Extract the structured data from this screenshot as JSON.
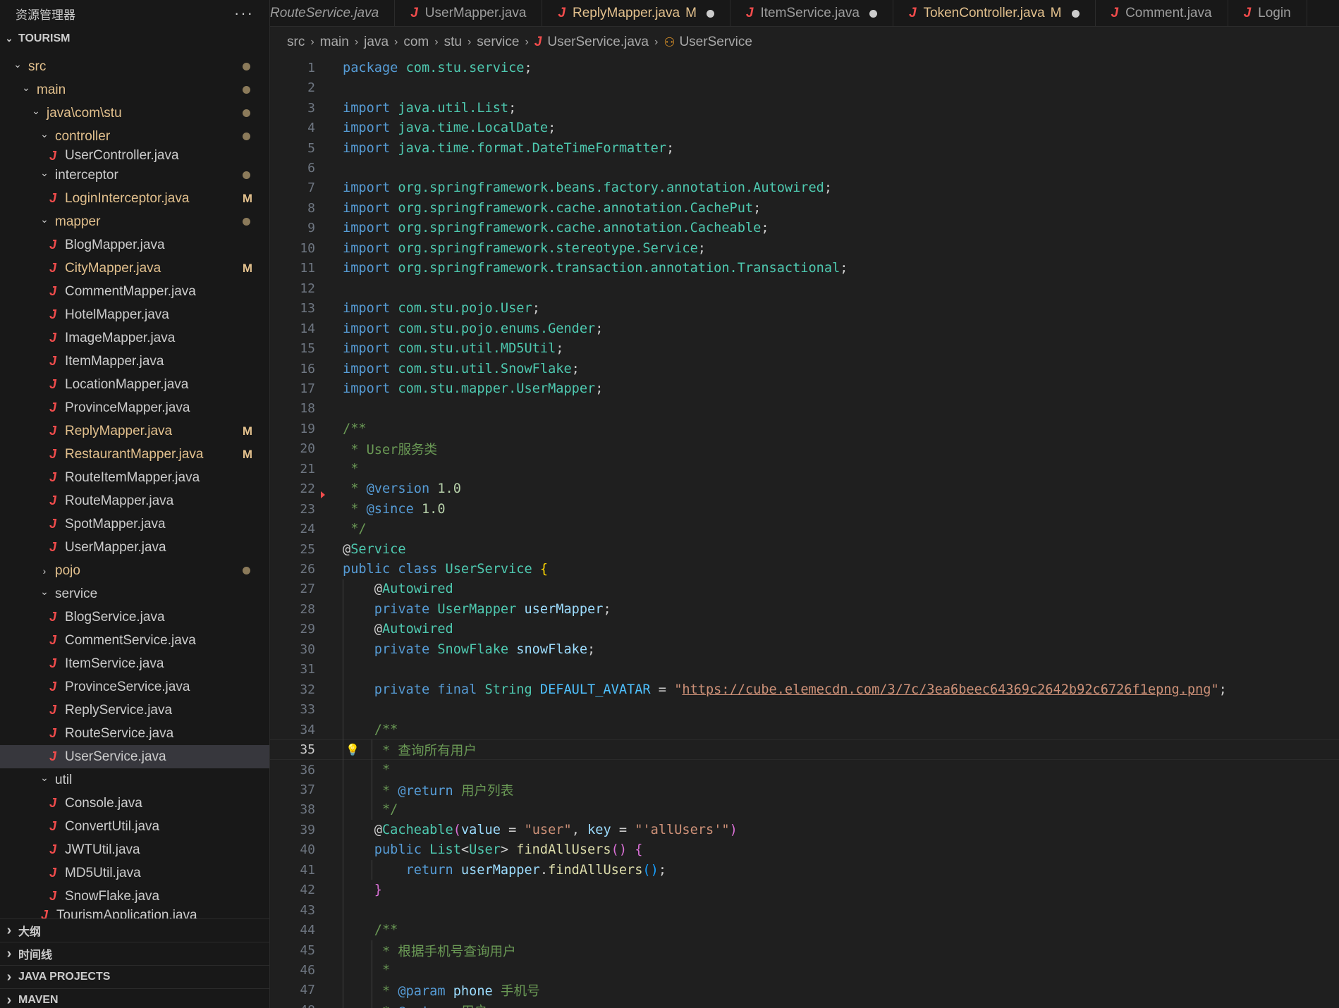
{
  "sidebar": {
    "title": "资源管理器",
    "more_icon": "ellipsis-icon",
    "root": "TOURISM",
    "tree": [
      {
        "label": "src",
        "depth": 1,
        "kind": "dir",
        "open": true,
        "dot": true
      },
      {
        "label": "main",
        "depth": 2,
        "kind": "dir",
        "open": true,
        "dot": true
      },
      {
        "label": "java\\com\\stu",
        "depth": 3,
        "kind": "dir",
        "open": true,
        "dot": true
      },
      {
        "label": "controller",
        "depth": 4,
        "kind": "dir",
        "open": true,
        "dot": true
      },
      {
        "label": "UserController.java",
        "depth": 5,
        "kind": "file",
        "partial": true
      },
      {
        "label": "interceptor",
        "depth": 4,
        "kind": "folder",
        "open": true,
        "dot": true
      },
      {
        "label": "LoginInterceptor.java",
        "depth": 5,
        "kind": "file",
        "modified": true,
        "badge": "M"
      },
      {
        "label": "mapper",
        "depth": 4,
        "kind": "dir",
        "open": true,
        "dot": true
      },
      {
        "label": "BlogMapper.java",
        "depth": 5,
        "kind": "file"
      },
      {
        "label": "CityMapper.java",
        "depth": 5,
        "kind": "file",
        "modified": true,
        "badge": "M"
      },
      {
        "label": "CommentMapper.java",
        "depth": 5,
        "kind": "file"
      },
      {
        "label": "HotelMapper.java",
        "depth": 5,
        "kind": "file"
      },
      {
        "label": "ImageMapper.java",
        "depth": 5,
        "kind": "file"
      },
      {
        "label": "ItemMapper.java",
        "depth": 5,
        "kind": "file"
      },
      {
        "label": "LocationMapper.java",
        "depth": 5,
        "kind": "file"
      },
      {
        "label": "ProvinceMapper.java",
        "depth": 5,
        "kind": "file"
      },
      {
        "label": "ReplyMapper.java",
        "depth": 5,
        "kind": "file",
        "modified": true,
        "badge": "M"
      },
      {
        "label": "RestaurantMapper.java",
        "depth": 5,
        "kind": "file",
        "modified": true,
        "badge": "M"
      },
      {
        "label": "RouteItemMapper.java",
        "depth": 5,
        "kind": "file"
      },
      {
        "label": "RouteMapper.java",
        "depth": 5,
        "kind": "file"
      },
      {
        "label": "SpotMapper.java",
        "depth": 5,
        "kind": "file"
      },
      {
        "label": "UserMapper.java",
        "depth": 5,
        "kind": "file"
      },
      {
        "label": "pojo",
        "depth": 4,
        "kind": "dir",
        "open": false,
        "dot": true
      },
      {
        "label": "service",
        "depth": 4,
        "kind": "folder",
        "open": true
      },
      {
        "label": "BlogService.java",
        "depth": 5,
        "kind": "file"
      },
      {
        "label": "CommentService.java",
        "depth": 5,
        "kind": "file"
      },
      {
        "label": "ItemService.java",
        "depth": 5,
        "kind": "file"
      },
      {
        "label": "ProvinceService.java",
        "depth": 5,
        "kind": "file"
      },
      {
        "label": "ReplyService.java",
        "depth": 5,
        "kind": "file"
      },
      {
        "label": "RouteService.java",
        "depth": 5,
        "kind": "file"
      },
      {
        "label": "UserService.java",
        "depth": 5,
        "kind": "file",
        "selected": true
      },
      {
        "label": "util",
        "depth": 4,
        "kind": "folder",
        "open": true
      },
      {
        "label": "Console.java",
        "depth": 5,
        "kind": "file"
      },
      {
        "label": "ConvertUtil.java",
        "depth": 5,
        "kind": "file"
      },
      {
        "label": "JWTUtil.java",
        "depth": 5,
        "kind": "file"
      },
      {
        "label": "MD5Util.java",
        "depth": 5,
        "kind": "file"
      },
      {
        "label": "SnowFlake.java",
        "depth": 5,
        "kind": "file"
      },
      {
        "label": "TourismApplication.java",
        "depth": 4,
        "kind": "file",
        "partial": true
      }
    ],
    "sections": [
      "大纲",
      "时间线",
      "JAVA PROJECTS",
      "MAVEN"
    ]
  },
  "tabs": [
    {
      "label": "RouteService.java",
      "icon": false,
      "italic": true
    },
    {
      "label": "UserMapper.java",
      "icon": true
    },
    {
      "label": "ReplyMapper.java",
      "icon": true,
      "modified": true,
      "mark": "M",
      "dot": true
    },
    {
      "label": "ItemService.java",
      "icon": true,
      "dot": true
    },
    {
      "label": "TokenController.java",
      "icon": true,
      "modified": true,
      "mark": "M",
      "dot": true
    },
    {
      "label": "Comment.java",
      "icon": true
    },
    {
      "label": "Login",
      "icon": true
    }
  ],
  "breadcrumb": [
    "src",
    "main",
    "java",
    "com",
    "stu",
    "service",
    "UserService.java",
    "UserService"
  ],
  "editor": {
    "current_line": 35,
    "lines": [
      {
        "n": 1,
        "t": [
          [
            "kw",
            "package "
          ],
          [
            "pkg",
            "com.stu.service"
          ],
          [
            "",
            "; "
          ]
        ]
      },
      {
        "n": 2,
        "t": []
      },
      {
        "n": 3,
        "t": [
          [
            "kw",
            "import "
          ],
          [
            "pkg",
            "java.util.List"
          ],
          [
            "",
            ";"
          ]
        ]
      },
      {
        "n": 4,
        "t": [
          [
            "kw",
            "import "
          ],
          [
            "pkg",
            "java.time.LocalDate"
          ],
          [
            "",
            ";"
          ]
        ]
      },
      {
        "n": 5,
        "t": [
          [
            "kw",
            "import "
          ],
          [
            "pkg",
            "java.time.format.DateTimeFormatter"
          ],
          [
            "",
            ";"
          ]
        ]
      },
      {
        "n": 6,
        "t": []
      },
      {
        "n": 7,
        "t": [
          [
            "kw",
            "import "
          ],
          [
            "pkg",
            "org.springframework.beans.factory.annotation.Autowired"
          ],
          [
            "",
            ";"
          ]
        ]
      },
      {
        "n": 8,
        "t": [
          [
            "kw",
            "import "
          ],
          [
            "pkg",
            "org.springframework.cache.annotation.CachePut"
          ],
          [
            "",
            ";"
          ]
        ]
      },
      {
        "n": 9,
        "t": [
          [
            "kw",
            "import "
          ],
          [
            "pkg",
            "org.springframework.cache.annotation.Cacheable"
          ],
          [
            "",
            ";"
          ]
        ]
      },
      {
        "n": 10,
        "t": [
          [
            "kw",
            "import "
          ],
          [
            "pkg",
            "org.springframework.stereotype.Service"
          ],
          [
            "",
            ";"
          ]
        ]
      },
      {
        "n": 11,
        "t": [
          [
            "kw",
            "import "
          ],
          [
            "pkg",
            "org.springframework.transaction.annotation.Transactional"
          ],
          [
            "",
            ";"
          ]
        ]
      },
      {
        "n": 12,
        "t": []
      },
      {
        "n": 13,
        "t": [
          [
            "kw",
            "import "
          ],
          [
            "pkg",
            "com.stu.pojo.User"
          ],
          [
            "",
            ";"
          ]
        ]
      },
      {
        "n": 14,
        "t": [
          [
            "kw",
            "import "
          ],
          [
            "pkg",
            "com.stu.pojo.enums.Gender"
          ],
          [
            "",
            ";"
          ]
        ]
      },
      {
        "n": 15,
        "t": [
          [
            "kw",
            "import "
          ],
          [
            "pkg",
            "com.stu.util.MD5Util"
          ],
          [
            "",
            ";"
          ]
        ]
      },
      {
        "n": 16,
        "t": [
          [
            "kw",
            "import "
          ],
          [
            "pkg",
            "com.stu.util.SnowFlake"
          ],
          [
            "",
            ";"
          ]
        ]
      },
      {
        "n": 17,
        "t": [
          [
            "kw",
            "import "
          ],
          [
            "pkg",
            "com.stu.mapper.UserMapper"
          ],
          [
            "",
            ";"
          ]
        ]
      },
      {
        "n": 18,
        "t": []
      },
      {
        "n": 19,
        "t": [
          [
            "cm",
            "/**"
          ]
        ]
      },
      {
        "n": 20,
        "t": [
          [
            "cm",
            " * User服务类"
          ]
        ]
      },
      {
        "n": 21,
        "t": [
          [
            "cm",
            " *"
          ]
        ]
      },
      {
        "n": 22,
        "t": [
          [
            "cm",
            " * "
          ],
          [
            "tag",
            "@version"
          ],
          [
            "num",
            " 1.0"
          ]
        ]
      },
      {
        "n": 23,
        "t": [
          [
            "cm",
            " * "
          ],
          [
            "tag",
            "@since"
          ],
          [
            "num",
            " 1.0"
          ]
        ]
      },
      {
        "n": 24,
        "t": [
          [
            "cm",
            " */"
          ]
        ]
      },
      {
        "n": 25,
        "t": [
          [
            "",
            "@"
          ],
          [
            "cls",
            "Service"
          ]
        ]
      },
      {
        "n": 26,
        "t": [
          [
            "kw",
            "public class "
          ],
          [
            "cls",
            "UserService "
          ],
          [
            "br1",
            "{"
          ]
        ]
      },
      {
        "n": 27,
        "t": [
          [
            "",
            "    @"
          ],
          [
            "cls",
            "Autowired"
          ]
        ]
      },
      {
        "n": 28,
        "t": [
          [
            "kw",
            "    private "
          ],
          [
            "cls",
            "UserMapper "
          ],
          [
            "var",
            "userMapper"
          ],
          [
            "",
            ";"
          ]
        ]
      },
      {
        "n": 29,
        "t": [
          [
            "",
            "    @"
          ],
          [
            "cls",
            "Autowired"
          ]
        ]
      },
      {
        "n": 30,
        "t": [
          [
            "kw",
            "    private "
          ],
          [
            "cls",
            "SnowFlake "
          ],
          [
            "var",
            "snowFlake"
          ],
          [
            "",
            ";"
          ]
        ]
      },
      {
        "n": 31,
        "t": []
      },
      {
        "n": 32,
        "t": [
          [
            "kw",
            "    private final "
          ],
          [
            "cls",
            "String "
          ],
          [
            "const",
            "DEFAULT_AVATAR"
          ],
          [
            "",
            " = "
          ],
          [
            "str",
            "\""
          ],
          [
            "url",
            "https://cube.elemecdn.com/3/7c/3ea6beec64369c2642b92c6726f1epng.png"
          ],
          [
            "str",
            "\""
          ],
          [
            "",
            ";"
          ]
        ]
      },
      {
        "n": 33,
        "t": []
      },
      {
        "n": 34,
        "t": [
          [
            "cm",
            "    /**"
          ]
        ]
      },
      {
        "n": 35,
        "t": [
          [
            "cm",
            "     * 查询所有用户"
          ]
        ]
      },
      {
        "n": 36,
        "t": [
          [
            "cm",
            "     *"
          ]
        ]
      },
      {
        "n": 37,
        "t": [
          [
            "cm",
            "     * "
          ],
          [
            "tag",
            "@return"
          ],
          [
            "cm",
            " 用户列表"
          ]
        ]
      },
      {
        "n": 38,
        "t": [
          [
            "cm",
            "     */"
          ]
        ]
      },
      {
        "n": 39,
        "t": [
          [
            "",
            "    @"
          ],
          [
            "cls",
            "Cacheable"
          ],
          [
            "br2",
            "("
          ],
          [
            "var",
            "value"
          ],
          [
            "",
            " = "
          ],
          [
            "str",
            "\"user\""
          ],
          [
            "",
            ", "
          ],
          [
            "var",
            "key"
          ],
          [
            "",
            " = "
          ],
          [
            "str",
            "\"'allUsers'\""
          ],
          [
            "br2",
            ")"
          ]
        ]
      },
      {
        "n": 40,
        "t": [
          [
            "kw",
            "    public "
          ],
          [
            "cls",
            "List"
          ],
          [
            "",
            "<"
          ],
          [
            "cls",
            "User"
          ],
          [
            "",
            "> "
          ],
          [
            "fn",
            "findAllUsers"
          ],
          [
            "br2",
            "()"
          ],
          [
            "",
            " "
          ],
          [
            "br2",
            "{"
          ]
        ]
      },
      {
        "n": 41,
        "t": [
          [
            "kw",
            "        return "
          ],
          [
            "var",
            "userMapper"
          ],
          [
            "",
            "."
          ],
          [
            "fn",
            "findAllUsers"
          ],
          [
            "br3",
            "()"
          ],
          [
            "",
            ";"
          ]
        ]
      },
      {
        "n": 42,
        "t": [
          [
            "br2",
            "    }"
          ]
        ]
      },
      {
        "n": 43,
        "t": []
      },
      {
        "n": 44,
        "t": [
          [
            "cm",
            "    /**"
          ]
        ]
      },
      {
        "n": 45,
        "t": [
          [
            "cm",
            "     * 根据手机号查询用户"
          ]
        ]
      },
      {
        "n": 46,
        "t": [
          [
            "cm",
            "     *"
          ]
        ]
      },
      {
        "n": 47,
        "t": [
          [
            "cm",
            "     * "
          ],
          [
            "tag",
            "@param"
          ],
          [
            "var",
            " phone"
          ],
          [
            "cm",
            " 手机号"
          ]
        ]
      },
      {
        "n": 48,
        "t": [
          [
            "cm",
            "     * "
          ],
          [
            "tag",
            "@return"
          ],
          [
            "cm",
            " 用户"
          ]
        ]
      }
    ]
  },
  "colors": {
    "accent": "#f14c4c",
    "modified": "#e2c08d",
    "background": "#1f1f1f",
    "sidebar": "#181818"
  }
}
